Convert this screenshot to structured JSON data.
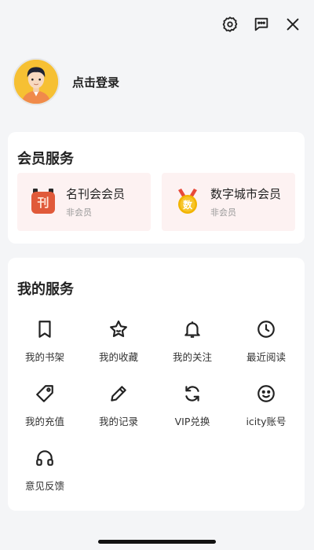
{
  "topbar": {
    "icons": [
      "settings-icon",
      "message-icon",
      "close-icon"
    ]
  },
  "profile": {
    "login_label": "点击登录",
    "avatar_bg": "#f6c033"
  },
  "membership": {
    "title": "会员服务",
    "items": [
      {
        "name": "名刊会会员",
        "status": "非会员",
        "badge_text": "刊",
        "badge_color": "#e05a3a"
      },
      {
        "name": "数字城市会员",
        "status": "非会员",
        "badge_text": "数",
        "badge_color": "#f2b400"
      }
    ]
  },
  "services": {
    "title": "我的服务",
    "items": [
      {
        "label": "我的书架",
        "icon": "bookmark-icon"
      },
      {
        "label": "我的收藏",
        "icon": "star-icon"
      },
      {
        "label": "我的关注",
        "icon": "bell-icon"
      },
      {
        "label": "最近阅读",
        "icon": "clock-icon"
      },
      {
        "label": "我的充值",
        "icon": "tag-icon"
      },
      {
        "label": "我的记录",
        "icon": "pencil-icon"
      },
      {
        "label": "VIP兑换",
        "icon": "refresh-icon"
      },
      {
        "label": "icity账号",
        "icon": "smile-icon"
      },
      {
        "label": "意见反馈",
        "icon": "headphones-icon"
      }
    ]
  }
}
